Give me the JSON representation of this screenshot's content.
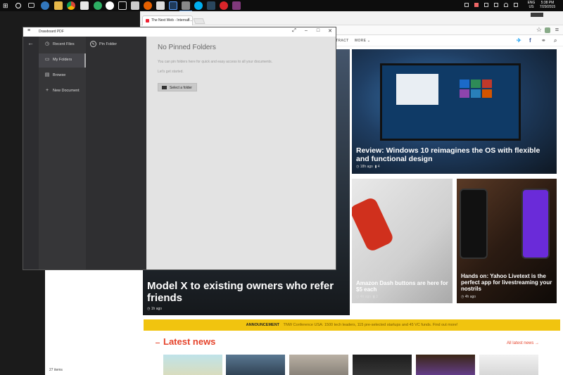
{
  "taskbar": {
    "icons": [
      "start-icon",
      "search-icon",
      "task-view-icon",
      "edge-icon",
      "explorer-icon",
      "store-icon",
      "chrome-icon",
      "sticker-icon",
      "circle-icon",
      "tasks-icon",
      "photo-icon",
      "firefox-icon",
      "outlook-icon",
      "photoshop-icon",
      "drawboard-icon",
      "skype-icon",
      "steam-icon",
      "opera-icon",
      "onenote-icon"
    ],
    "lang_top": "ENG",
    "lang_bottom": "US",
    "time": "5:38 PM",
    "date": "7/29/2015"
  },
  "explorer": {
    "items_count": "27 items"
  },
  "browser": {
    "tab_title": "The Next Web - Internati...",
    "nav_items": [
      "TRACT",
      "MORE ⌄"
    ],
    "hero": {
      "main_title": "Model X to existing owners who refer friends",
      "main_meta": "1h ago",
      "win_title": "Review: Windows 10 reimagines the OS with flexible and functional design",
      "win_meta_time": "18h ago",
      "win_meta_comments": "4",
      "dash_title": "Amazon Dash buttons are here for $5 each",
      "dash_meta_time": "4h ago",
      "dash_meta_comments": "3",
      "yahoo_title": "Hands on: Yahoo Livetext is the perfect app for livestreaming your nostrils",
      "yahoo_meta": "4h ago"
    },
    "announcement_label": "ANNOUNCEMENT",
    "announcement_text": "TNW Conference USA: 1500 tech leaders, 115 pre-selected startups and 45 VC funds. Find out more!",
    "latest_title": "Latest news",
    "all_news": "All latest news →"
  },
  "app": {
    "title": "Drawboard PDF",
    "nav": {
      "recent": "Recent Files",
      "folders": "My Folders",
      "browse": "Browse",
      "new_doc": "New Document"
    },
    "pin_folder": "Pin Folder",
    "heading": "No Pinned Folders",
    "desc": "You can pin folders here for quick and easy access to all your documents.",
    "start": "Let's get started.",
    "select_button": "Select a folder"
  },
  "colors": {
    "accent_red": "#e5432b",
    "announce_yellow": "#f1c40f"
  }
}
